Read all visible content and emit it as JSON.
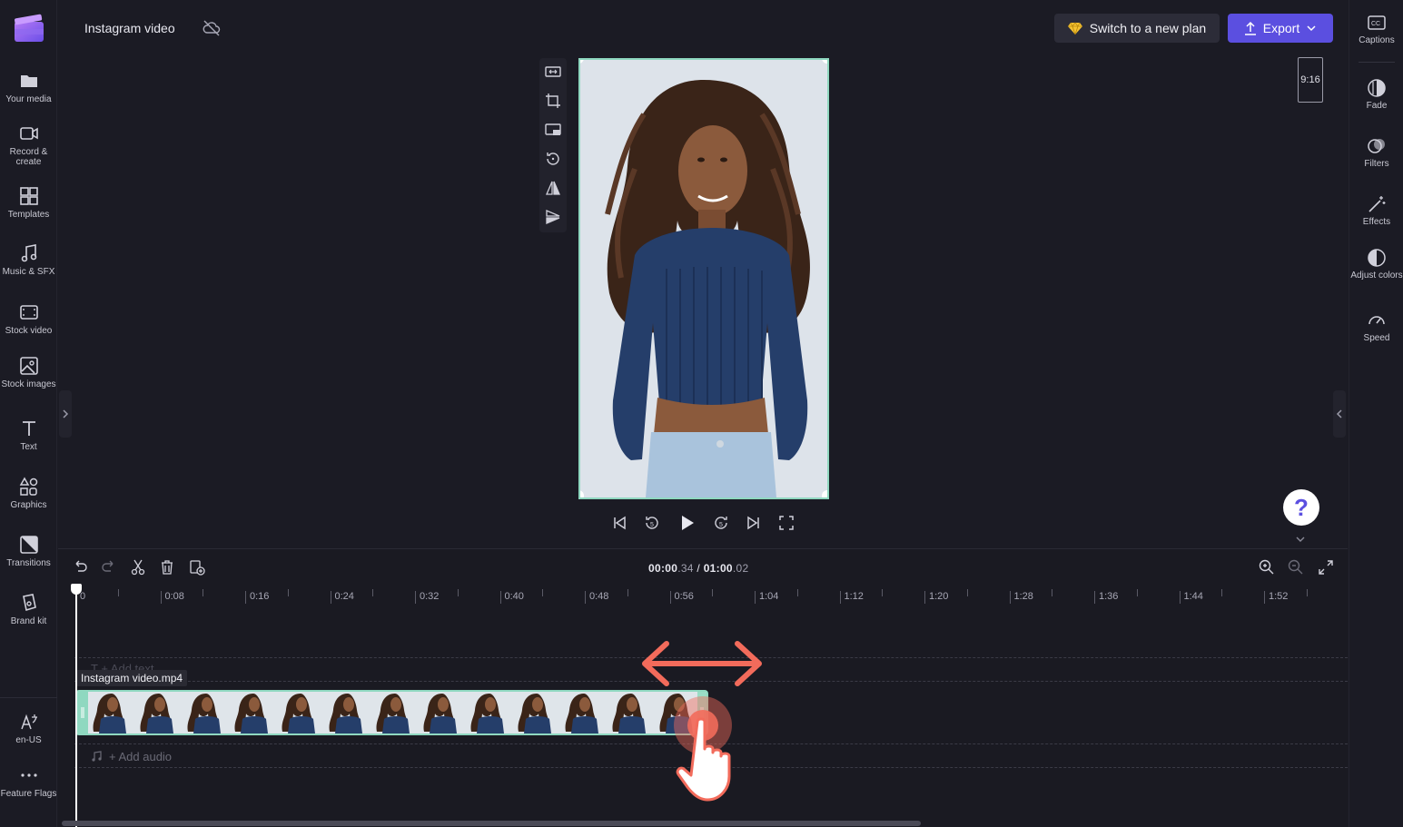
{
  "header": {
    "project_title": "Instagram video",
    "plan_button": "Switch to a new plan",
    "export_button": "Export"
  },
  "left_nav": [
    {
      "label": "Your media",
      "icon": "folder-icon"
    },
    {
      "label": "Record & create",
      "icon": "video-camera-icon"
    },
    {
      "label": "Templates",
      "icon": "templates-icon"
    },
    {
      "label": "Music & SFX",
      "icon": "music-icon"
    },
    {
      "label": "Stock video",
      "icon": "film-icon"
    },
    {
      "label": "Stock images",
      "icon": "image-icon"
    },
    {
      "label": "Text",
      "icon": "text-icon"
    },
    {
      "label": "Graphics",
      "icon": "shapes-icon"
    },
    {
      "label": "Transitions",
      "icon": "transitions-icon"
    },
    {
      "label": "Brand kit",
      "icon": "brand-kit-icon"
    }
  ],
  "left_nav_bottom": [
    {
      "label": "en-US",
      "icon": "language-icon"
    },
    {
      "label": "Feature Flags",
      "icon": "more-icon"
    }
  ],
  "right_nav": [
    {
      "label": "Captions",
      "icon": "captions-icon"
    },
    {
      "label": "Fade",
      "icon": "fade-icon"
    },
    {
      "label": "Filters",
      "icon": "filters-icon"
    },
    {
      "label": "Effects",
      "icon": "effects-icon"
    },
    {
      "label": "Adjust colors",
      "icon": "adjust-colors-icon"
    },
    {
      "label": "Speed",
      "icon": "speed-icon"
    }
  ],
  "preview": {
    "aspect_ratio": "9:16"
  },
  "timeline": {
    "current_time": "00:00",
    "current_frac": ".34",
    "separator": " / ",
    "total_time": "01:00",
    "total_frac": ".02",
    "ruler_labels": [
      "0",
      "0:08",
      "0:16",
      "0:24",
      "0:32",
      "0:40",
      "0:48",
      "0:56",
      "1:04",
      "1:12",
      "1:20",
      "1:28",
      "1:36",
      "1:44",
      "1:52"
    ],
    "add_text_placeholder": "T  + Add text",
    "clip_name": "Instagram video.mp4",
    "add_audio_label": "+ Add audio"
  },
  "help": {
    "label": "?"
  },
  "colors": {
    "accent": "#5b4fe0",
    "clip_border": "#8fd8c0",
    "drag_arrow": "#f26b5b"
  }
}
